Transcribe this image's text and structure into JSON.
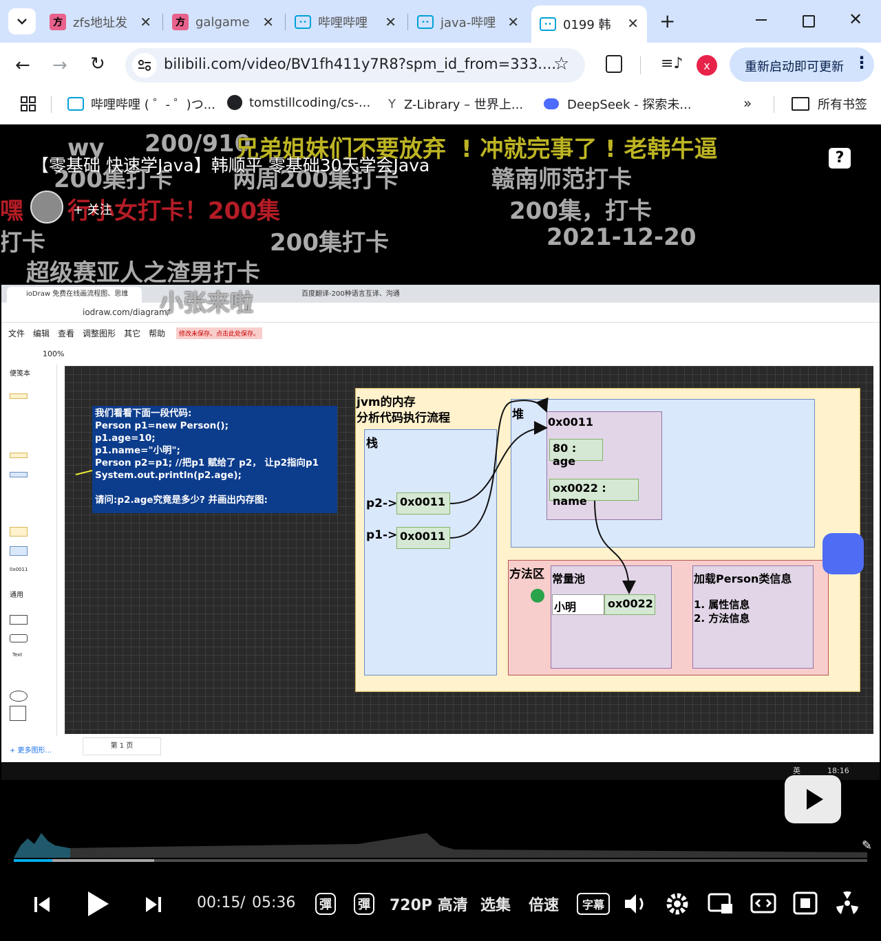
{
  "tabs": [
    {
      "label": "zfs地址发",
      "icon": "fang-icon"
    },
    {
      "label": "galgame",
      "icon": "fang-icon"
    },
    {
      "label": "哔哩哔哩",
      "icon": "bilibili-icon"
    },
    {
      "label": "java-哔哩",
      "icon": "bilibili-icon"
    },
    {
      "label": "0199 韩",
      "icon": "bilibili-icon",
      "active": true
    }
  ],
  "address": "bilibili.com/video/BV1fh411y7R8?spm_id_from=333....",
  "update_button": "重新启动即可更新",
  "profile_letter": "x",
  "bookmarks": [
    {
      "label": "哔哩哔哩 ( ゜- ゜)つ...",
      "icon": "bilibili-icon"
    },
    {
      "label": "tomstillcoding/cs-...",
      "icon": "github-icon"
    },
    {
      "label": "Z-Library – 世界上...",
      "icon": "zlibrary-icon"
    },
    {
      "label": "DeepSeek - 探索未...",
      "icon": "deepseek-icon"
    }
  ],
  "all_bookmarks": "所有书签",
  "video": {
    "title": "【零基础 快速学Java】韩顺平 零基础30天学会Java",
    "follow": "+ 关注",
    "danmaku": [
      "200/910",
      "兄弟姐妹们不要放弃",
      "! 冲就完事了 ! 老韩牛逼",
      "wy",
      "200集打卡",
      "两周200集打卡",
      "赣南师范打卡",
      "嘿",
      "行小女打卡！200集",
      "200集，打卡",
      "打卡",
      "200集打卡",
      "2021-12-20",
      "超级赛亚人之渣男打卡",
      "小张来啦"
    ]
  },
  "inner": {
    "tabs": [
      "ioDraw 免费在线画流程图、思维",
      "百度翻译-200种语言互译、沟通"
    ],
    "url": "iodraw.com/diagram/",
    "menu": [
      "文件",
      "编辑",
      "查看",
      "调整图形",
      "其它",
      "帮助"
    ],
    "save_notice": "修改未保存。点击此处保存。",
    "zoom": "100%",
    "sidebar_title": "便笺本",
    "general": "通用",
    "more_shapes": "+ 更多图形...",
    "page_tab": "第 1 页",
    "clock": "18:16",
    "lang": "英",
    "note": {
      "lines": [
        "我们看看下面一段代码:",
        "Person p1=new Person();",
        "p1.age=10;",
        "p1.name=\"小明\";",
        "Person p2=p1; //把p1 赋给了 p2， 让p2指向p1",
        "System.out.println(p2.age);",
        "",
        "请问:p2.age究竟是多少? 并画出内存图:"
      ]
    },
    "diagram": {
      "title1": "jvm的内存",
      "title2": "分析代码执行流程",
      "stack": "栈",
      "heap": "堆",
      "p2": "p2->",
      "p1": "p1->",
      "p2_val": "0x0011",
      "p1_val": "0x0011",
      "obj_addr": "0x0011",
      "age": "80 : age",
      "name": "ox0022 : name",
      "method_area": "方法区",
      "const_pool": "常量池",
      "xiaoming": "小明",
      "xiaoming_addr": "ox0022",
      "class_info": "加载Person类信息",
      "attr1": "1. 属性信息",
      "attr2": "2. 方法信息",
      "sidebar_label": "0x0011",
      "text_label": "Text"
    }
  },
  "player": {
    "time_current": "00:15",
    "time_sep": "/",
    "time_total": "05:36",
    "quality": "720P 高清",
    "episodes": "选集",
    "speed": "倍速",
    "progress": 0.045
  }
}
